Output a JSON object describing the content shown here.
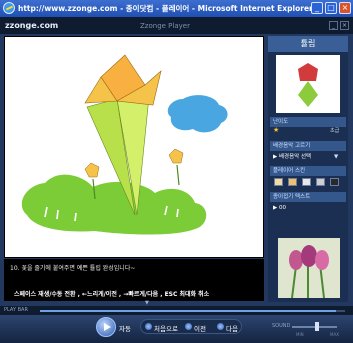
{
  "window": {
    "title": "http://www.zzonge.com - 종이닷컴 - 플레이어 - Microsoft Internet Explorer",
    "min": "_",
    "max": "□",
    "close": "×"
  },
  "app": {
    "logo": "zzonge.com",
    "name": "Zzonge Player",
    "min": "_",
    "close": "×"
  },
  "stage": {
    "caption": "10. 꽃을 줄기에 붙여주면 예쁜 튤립 완성입니다~",
    "shortcuts": "스페이스 재생/수동 전환 , ←느리게/이전 , →빠르게/다음 , ESC 최대화 취소",
    "drop_indicator": "▼"
  },
  "sidebar": {
    "title": "튤립",
    "star_icon": "★",
    "star_label": "초급",
    "rows": [
      {
        "label": "난이도",
        "type": "header"
      },
      {
        "label": "배경음악 고르기",
        "type": "header",
        "arrow": "▼"
      },
      {
        "label": "▶ 배경음악 선택",
        "type": "item"
      },
      {
        "label": "플레이어 스킨",
        "type": "header"
      },
      {
        "label": "종이접기 텍스트",
        "type": "header"
      },
      {
        "label": "▶ 00",
        "type": "item"
      }
    ],
    "skin_colors": [
      "#f4d9a0",
      "#f2c06a",
      "#e8e8e8",
      "#cfcfcf",
      "#2a2a2a"
    ]
  },
  "playbar": {
    "label": "PLAY BAR",
    "progress": 0.97
  },
  "controls": {
    "play_label": "자동",
    "first_label": "처음으로",
    "prev_label": "이전",
    "next_label": "다음",
    "sound_label": "SOUND",
    "vol_min": "MIN",
    "vol_max": "MAX",
    "volume": 0.55
  },
  "colors": {
    "accent": "#3a5f96",
    "tulip_yellow": "#f5c34a",
    "leaf_green": "#b8e04a",
    "water_blue": "#4aa6e0"
  }
}
